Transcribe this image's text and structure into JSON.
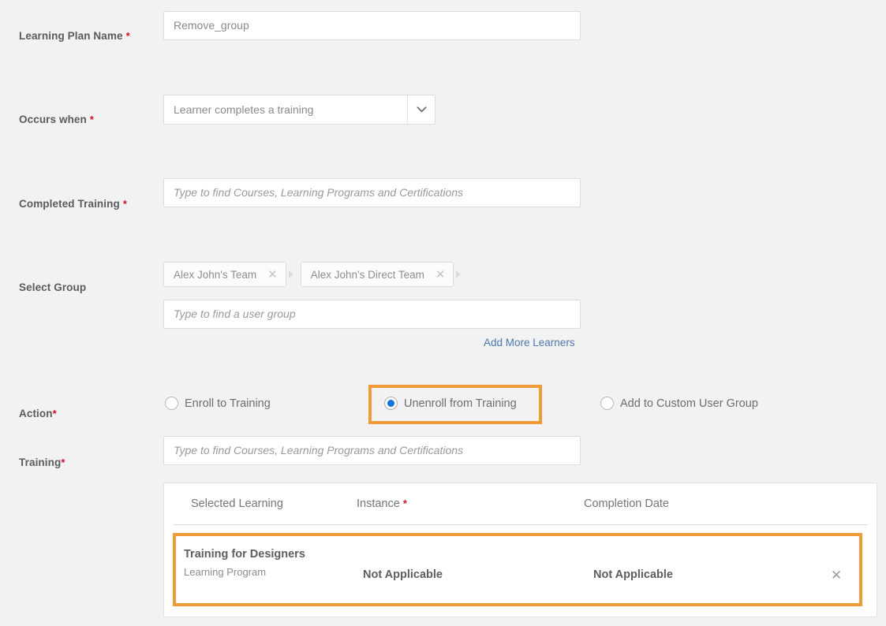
{
  "colors": {
    "page_background": "#f2f2f2",
    "highlight_orange": "#f09a38",
    "required_red": "#d0112b",
    "radio_selected_blue": "#1473d6",
    "link_blue": "#4c79ae"
  },
  "fields": {
    "learning_plan_name": {
      "label": "Learning Plan Name",
      "required": true,
      "value": "Remove_group"
    },
    "occurs_when": {
      "label": "Occurs when",
      "required": true,
      "value": "Learner completes a training",
      "chevron_icon": "chevron-down-icon"
    },
    "completed_training": {
      "label": "Completed Training",
      "required": true,
      "value": "",
      "placeholder": "Type to find Courses, Learning Programs and Certifications"
    },
    "select_group": {
      "label": "Select Group",
      "required": false,
      "chips": [
        {
          "label": "Alex John's Team",
          "remove_icon": "close-icon"
        },
        {
          "label": "Alex John's Direct Team",
          "remove_icon": "close-icon"
        }
      ],
      "value": "",
      "placeholder": "Type to find a user group",
      "add_more_link": "Add More Learners"
    },
    "action": {
      "label": "Action",
      "required": true,
      "options": [
        {
          "label": "Enroll to Training",
          "selected": false
        },
        {
          "label": "Unenroll from Training",
          "selected": true
        },
        {
          "label": "Add to Custom User Group",
          "selected": false
        }
      ]
    },
    "training": {
      "label": "Training",
      "required": true,
      "value": "",
      "placeholder": "Type to find Courses, Learning Programs and Certifications"
    }
  },
  "training_table": {
    "columns": [
      {
        "label": "Selected Learning",
        "required": false
      },
      {
        "label": "Instance",
        "required": true
      },
      {
        "label": "Completion Date",
        "required": false
      }
    ],
    "rows": [
      {
        "selected_learning": "Training for Designers",
        "selected_learning_type": "Learning Program",
        "instance": "Not Applicable",
        "completion_date": "Not Applicable",
        "remove_icon": "close-icon"
      }
    ]
  }
}
